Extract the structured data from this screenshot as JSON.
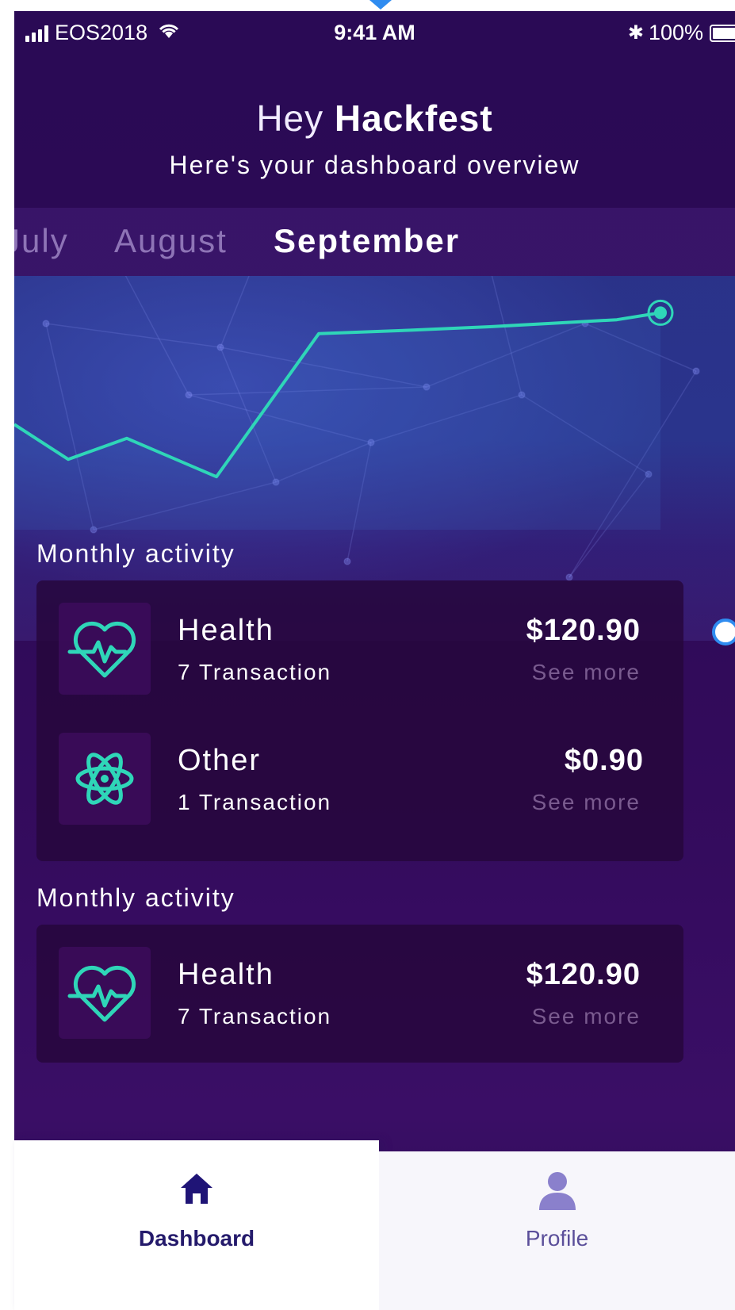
{
  "status_bar": {
    "carrier": "EOS2018",
    "time": "9:41 AM",
    "battery": "100%"
  },
  "header": {
    "greeting_prefix": "Hey",
    "user_name": "Hackfest",
    "subtitle": "Here's your dashboard overview"
  },
  "months": [
    {
      "label": "July",
      "active": false
    },
    {
      "label": "August",
      "active": false
    },
    {
      "label": "September",
      "active": true
    }
  ],
  "chart_data": {
    "type": "line",
    "series": [
      {
        "values": [
          0.62,
          0.52,
          0.58,
          0.47,
          0.88,
          0.89,
          0.9,
          0.91,
          0.92,
          0.94
        ]
      }
    ],
    "highlight_last_point": true,
    "colors": {
      "line": "#2fd6b8",
      "point": "#2fd6b8"
    }
  },
  "sections": [
    {
      "title": "Monthly activity",
      "items": [
        {
          "icon": "heartbeat-icon",
          "name": "Health",
          "transactions": "7 Transaction",
          "amount": "$120.90",
          "link": "See more"
        },
        {
          "icon": "atom-icon",
          "name": "Other",
          "transactions": "1 Transaction",
          "amount": "$0.90",
          "link": "See more"
        }
      ]
    },
    {
      "title": "Monthly activity",
      "items": [
        {
          "icon": "heartbeat-icon",
          "name": "Health",
          "transactions": "7 Transaction",
          "amount": "$120.90",
          "link": "See more"
        }
      ]
    }
  ],
  "tab_bar": {
    "dashboard_label": "Dashboard",
    "profile_label": "Profile",
    "active": "Dashboard",
    "colors": {
      "active": "#2a1a7a",
      "inactive": "#8a7fc9"
    }
  },
  "theme": {
    "accent": "#2fd6b8",
    "background": "#2c0b55"
  }
}
